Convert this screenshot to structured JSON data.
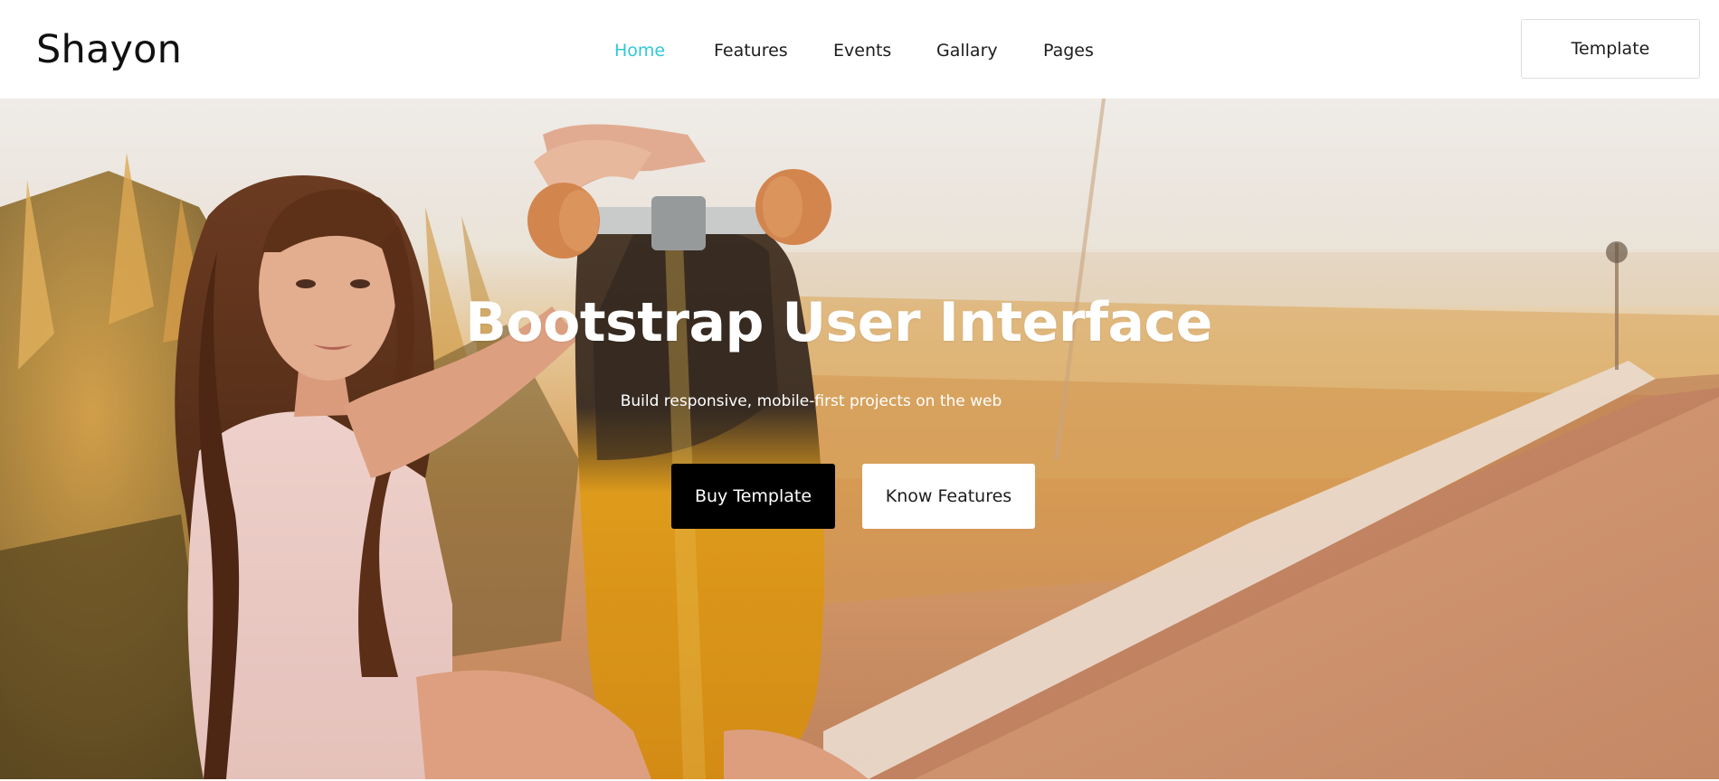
{
  "header": {
    "brand": "Shayon",
    "nav": [
      {
        "label": "Home",
        "active": true
      },
      {
        "label": "Features",
        "active": false
      },
      {
        "label": "Events",
        "active": false
      },
      {
        "label": "Gallary",
        "active": false
      },
      {
        "label": "Pages",
        "active": false
      }
    ],
    "template_button": "Template"
  },
  "hero": {
    "title": "Bootstrap User Interface",
    "subtitle": "Build responsive, mobile-first projects on the web",
    "buy_button": "Buy Template",
    "features_button": "Know Features"
  },
  "colors": {
    "accent": "#30c9d6",
    "text": "#1d1d1d",
    "button_dark": "#000000",
    "button_light": "#ffffff"
  }
}
